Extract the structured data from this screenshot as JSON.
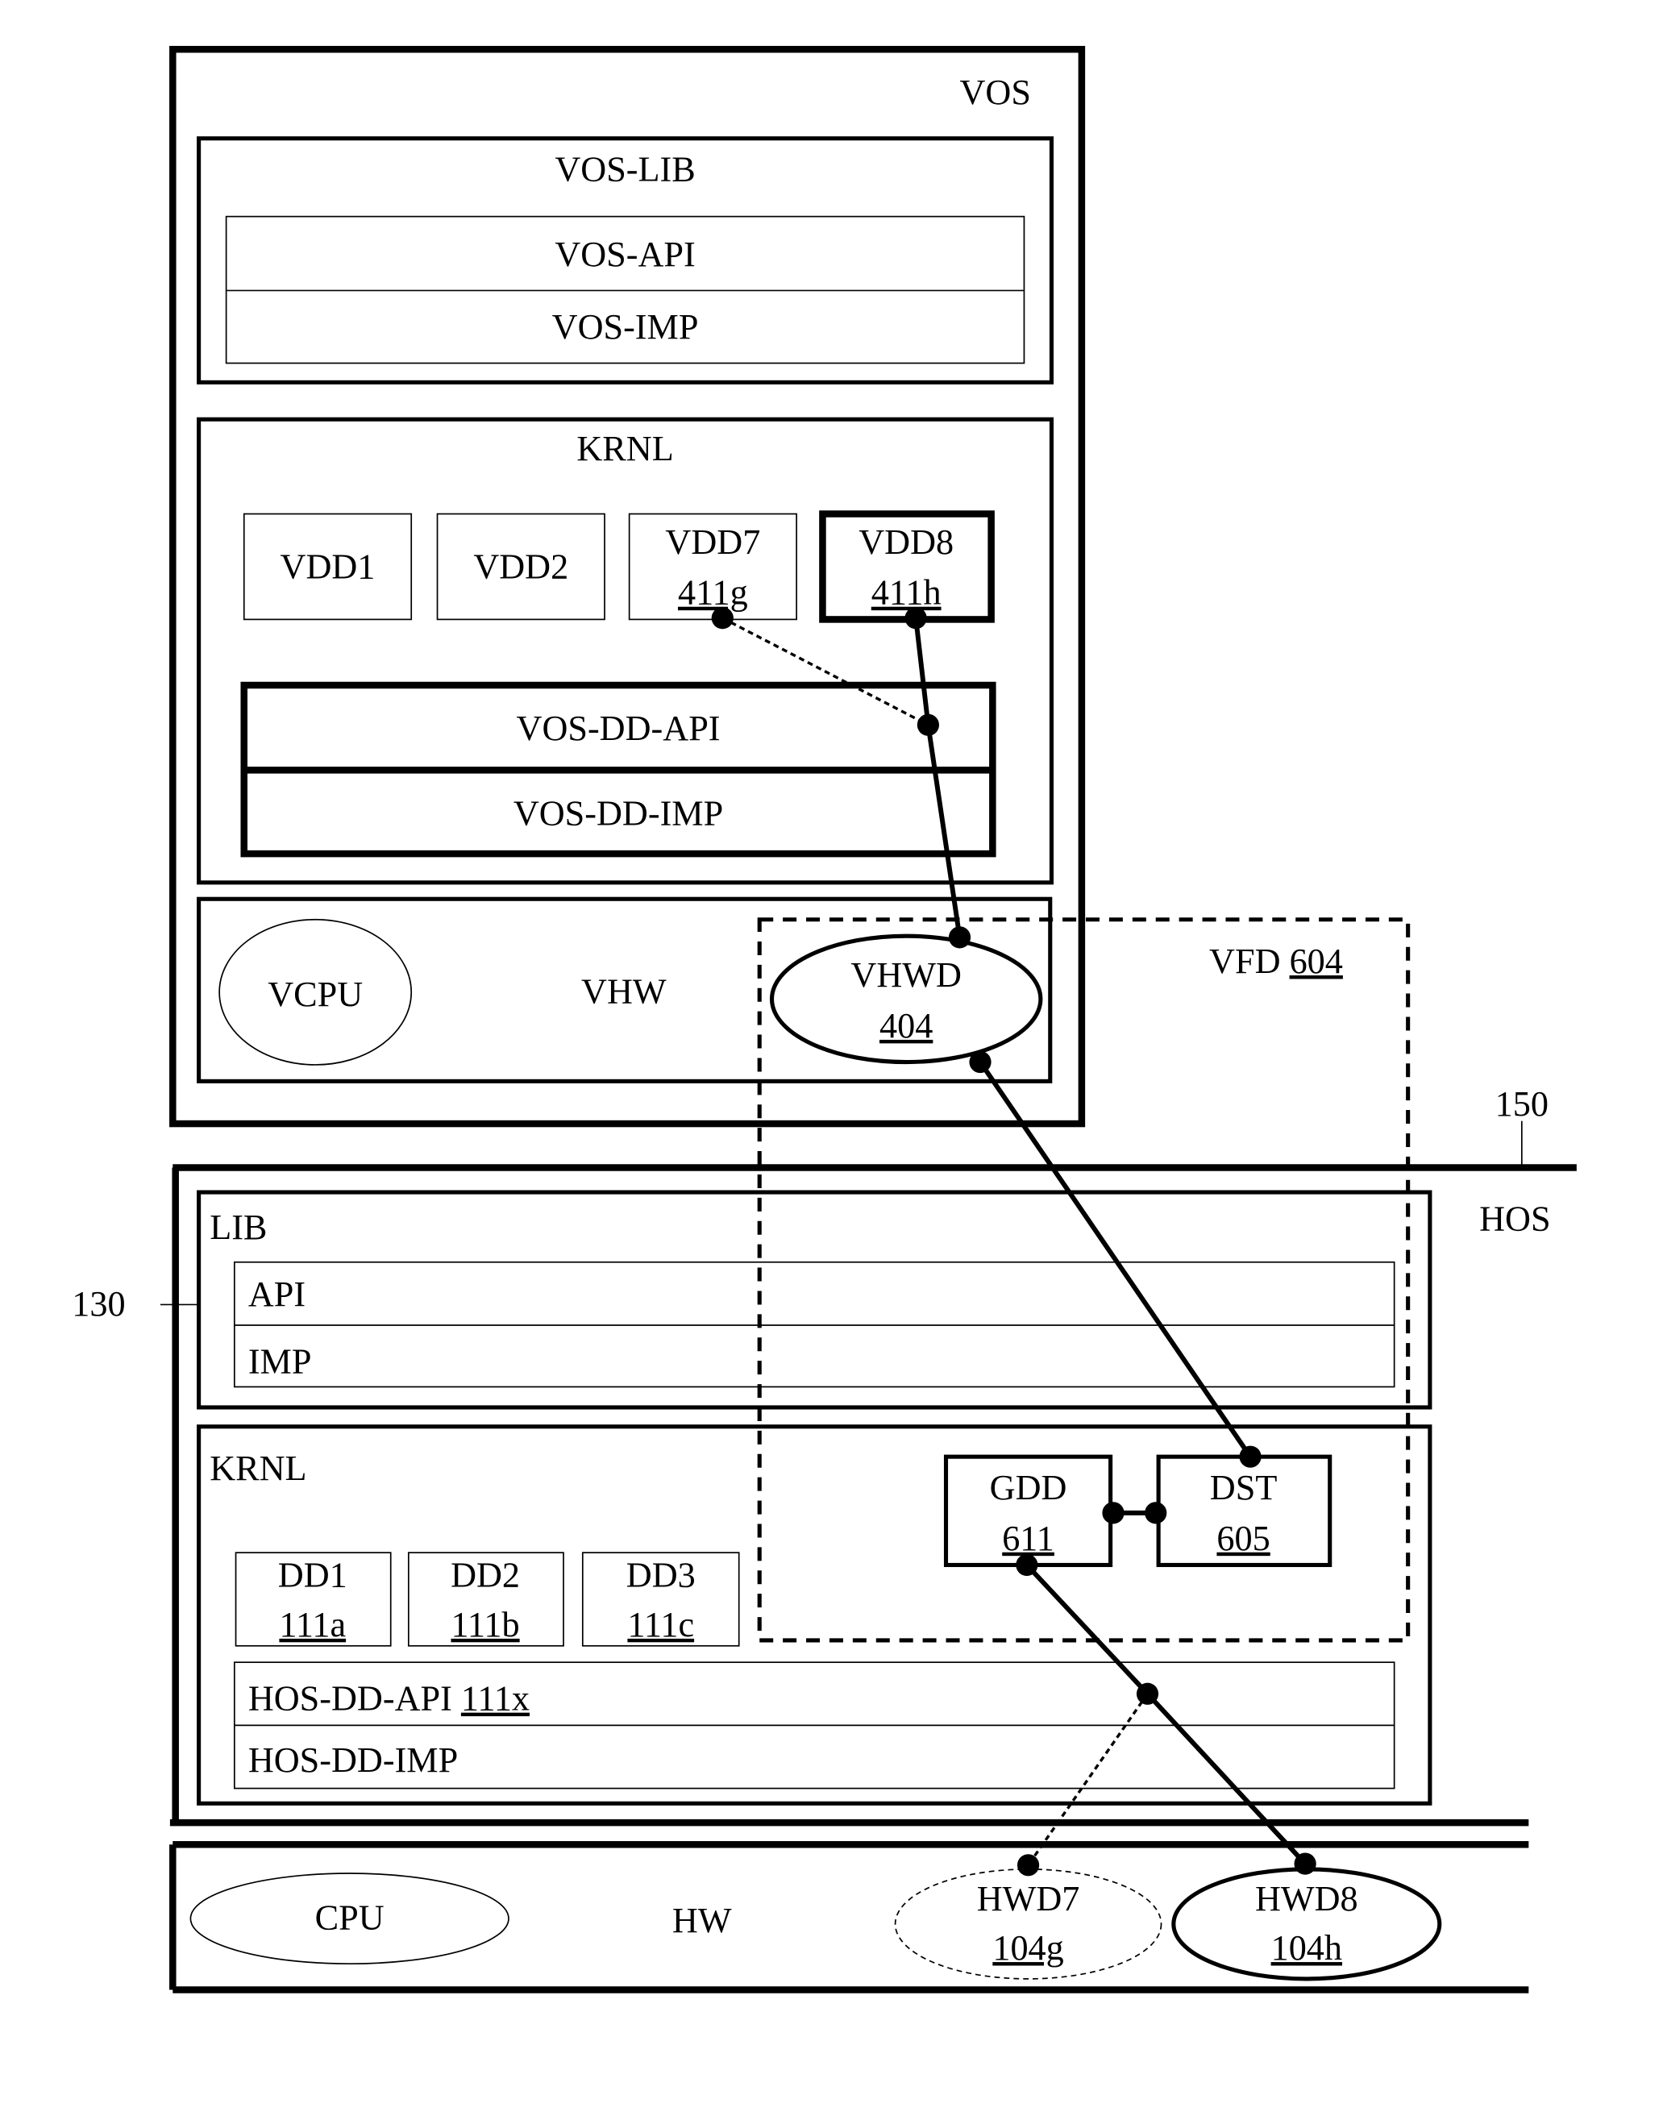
{
  "figure": {
    "vos": {
      "label": "VOS",
      "lib": {
        "label": "VOS-LIB",
        "api": "VOS-API",
        "imp": "VOS-IMP"
      },
      "krnl": {
        "label": "KRNL",
        "drivers": [
          {
            "name": "VDD1",
            "ref": ""
          },
          {
            "name": "VDD2",
            "ref": ""
          },
          {
            "name": "VDD7",
            "ref": "411g"
          },
          {
            "name": "VDD8",
            "ref": "411h"
          }
        ],
        "dd_api": "VOS-DD-API",
        "dd_imp": "VOS-DD-IMP"
      },
      "vhw": {
        "label": "VHW",
        "vcpu": "VCPU",
        "vhwd": {
          "name": "VHWD",
          "ref": "404"
        }
      }
    },
    "vfd": {
      "name": "VFD",
      "ref": "604"
    },
    "ref_150": "150",
    "ref_130": "130",
    "hos": {
      "label": "HOS",
      "lib": {
        "label": "LIB",
        "api": "API",
        "imp": "IMP"
      },
      "krnl": {
        "label": "KRNL",
        "drivers": [
          {
            "name": "DD1",
            "ref": "111a"
          },
          {
            "name": "DD2",
            "ref": "111b"
          },
          {
            "name": "DD3",
            "ref": "111c"
          }
        ],
        "gdd": {
          "name": "GDD",
          "ref": "611"
        },
        "dst": {
          "name": "DST",
          "ref": "605"
        },
        "dd_api": {
          "name": "HOS-DD-API",
          "ref": "111x"
        },
        "dd_imp": "HOS-DD-IMP"
      }
    },
    "hw": {
      "label": "HW",
      "cpu": "CPU",
      "hwd7": {
        "name": "HWD7",
        "ref": "104g"
      },
      "hwd8": {
        "name": "HWD8",
        "ref": "104h"
      }
    }
  }
}
